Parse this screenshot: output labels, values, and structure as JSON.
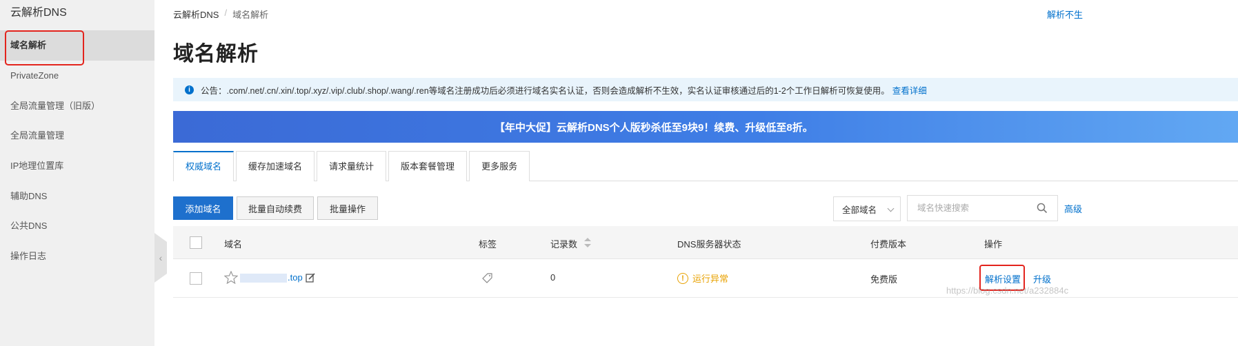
{
  "sidebar": {
    "title": "云解析DNS",
    "items": [
      {
        "label": "域名解析",
        "active": true
      },
      {
        "label": "PrivateZone"
      },
      {
        "label": "全局流量管理（旧版）"
      },
      {
        "label": "全局流量管理"
      },
      {
        "label": "IP地理位置库"
      },
      {
        "label": "辅助DNS"
      },
      {
        "label": "公共DNS"
      },
      {
        "label": "操作日志"
      }
    ],
    "collapse_glyph": "‹"
  },
  "breadcrumb": {
    "root": "云解析DNS",
    "sep": "/",
    "current": "域名解析"
  },
  "top_link": "解析不生",
  "page_title": "域名解析",
  "notice": {
    "prefix": "公告：",
    "text": ".com/.net/.cn/.xin/.top/.xyz/.vip/.club/.shop/.wang/.ren等域名注册成功后必须进行域名实名认证，否则会造成解析不生效，实名认证审核通过后的1-2个工作日解析可恢复使用。",
    "link": "查看详细"
  },
  "banner": "【年中大促】云解析DNS个人版秒杀低至9块9！续费、升级低至8折。",
  "tabs": [
    "权威域名",
    "缓存加速域名",
    "请求量统计",
    "版本套餐管理",
    "更多服务"
  ],
  "toolbar": {
    "add": "添加域名",
    "auto_renew": "批量自动续费",
    "batch": "批量操作",
    "filter_value": "全部域名",
    "search_placeholder": "域名快速搜索",
    "advanced": "高级"
  },
  "table": {
    "headers": {
      "domain": "域名",
      "tag": "标签",
      "records": "记录数",
      "dns_status": "DNS服务器状态",
      "plan": "付费版本",
      "ops": "操作"
    },
    "rows": [
      {
        "domain_suffix": ".top",
        "records": "0",
        "dns_status": "运行异常",
        "plan": "免费版",
        "op_resolve": "解析设置",
        "op_upgrade": "升级"
      }
    ]
  },
  "watermark": "https://blog.csdn.net/a232884c",
  "colors": {
    "accent": "#0070cc",
    "warning": "#e8a100",
    "highlight": "#e3231c"
  }
}
